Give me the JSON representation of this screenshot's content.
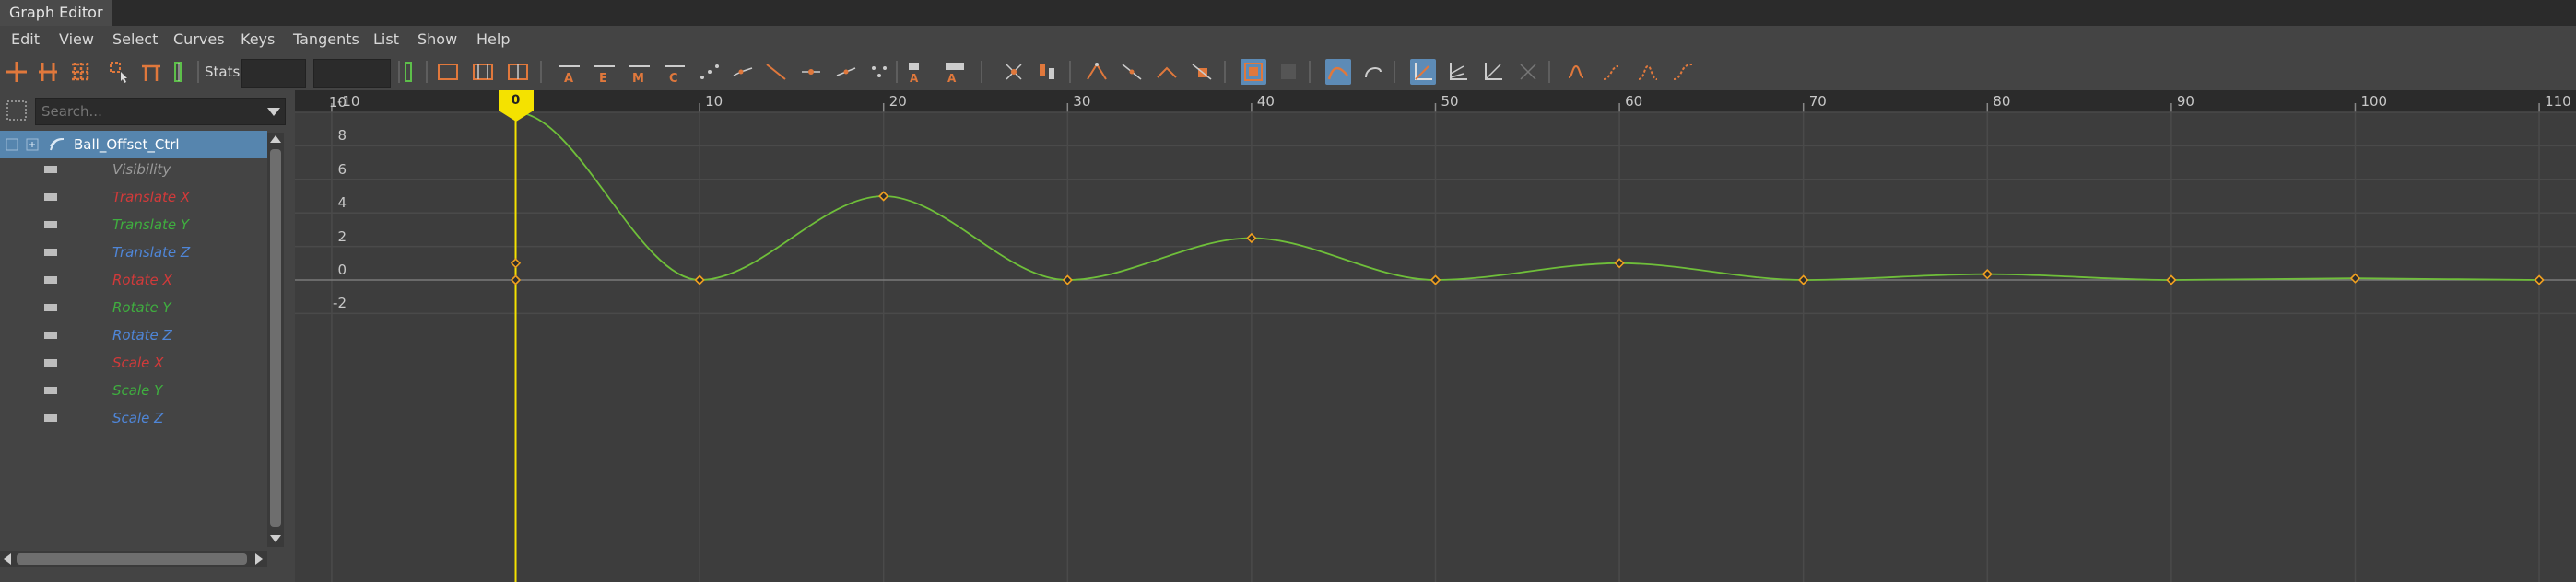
{
  "window": {
    "title": "Graph Editor"
  },
  "menu": [
    "Edit",
    "View",
    "Select",
    "Curves",
    "Keys",
    "Tangents",
    "List",
    "Show",
    "Help"
  ],
  "toolbar": {
    "stats_label": "Stats",
    "icons": [
      "move-keys-icon",
      "insert-keys-icon",
      "lattice-deform-icon",
      "region-select-icon",
      "retime-icon",
      "frame-all-icon",
      "frame-playback-icon",
      "center-current-icon",
      "auto-tangent-icon",
      "spline-tangent-icon",
      "clamped-tangent-icon",
      "linear-tangent-icon",
      "flat-tangent-icon",
      "step-tangent-icon",
      "step-next-icon",
      "plateau-tangent-icon",
      "break-tangents-icon",
      "unify-tangents-icon",
      "free-weights-icon",
      "lock-weights-icon",
      "buffer-curve-icon",
      "swap-buffer-icon",
      "snap-icon",
      "curve-sync-icon",
      "normalize-icon",
      "denormalize-icon",
      "pre-infinity-icon",
      "post-infinity-icon",
      "cycle-icon",
      "oscillate-icon"
    ]
  },
  "outliner": {
    "search_placeholder": "Search...",
    "node": "Ball_Offset_Ctrl",
    "channels": [
      {
        "label": "Visibility",
        "color": "#9a9a9a"
      },
      {
        "label": "Translate X",
        "color": "#d23a3a"
      },
      {
        "label": "Translate Y",
        "color": "#3fae3f"
      },
      {
        "label": "Translate Z",
        "color": "#4f86d8"
      },
      {
        "label": "Rotate X",
        "color": "#d23a3a"
      },
      {
        "label": "Rotate Y",
        "color": "#3fae3f"
      },
      {
        "label": "Rotate Z",
        "color": "#4f86d8"
      },
      {
        "label": "Scale X",
        "color": "#d23a3a"
      },
      {
        "label": "Scale Y",
        "color": "#3fae3f"
      },
      {
        "label": "Scale Z",
        "color": "#4f86d8"
      }
    ]
  },
  "graph": {
    "current_frame": "0",
    "curve_color": "#6fbf3a",
    "key_color": "#f0a020",
    "marker_color": "#f4e200"
  },
  "chart_data": {
    "type": "line",
    "x_ticks": [
      -10,
      0,
      10,
      20,
      30,
      40,
      50,
      60,
      70,
      80,
      90,
      100,
      110
    ],
    "x_tick_labels": [
      "-10",
      "0",
      "10",
      "20",
      "30",
      "40",
      "50",
      "60",
      "70",
      "80",
      "90",
      "100",
      "110"
    ],
    "y_ticks": [
      10,
      8,
      6,
      4,
      2,
      0,
      -2
    ],
    "y_tick_labels": [
      "10",
      "8",
      "6",
      "4",
      "2",
      "0",
      "-2"
    ],
    "xlim": [
      -12,
      112
    ],
    "ylim": [
      -2.5,
      12.2
    ],
    "series": [
      {
        "keys": [
          {
            "x": 0,
            "y": 10
          },
          {
            "x": 10,
            "y": 0
          },
          {
            "x": 20,
            "y": 5
          },
          {
            "x": 30,
            "y": 0
          },
          {
            "x": 40,
            "y": 2.5
          },
          {
            "x": 50,
            "y": 0
          },
          {
            "x": 60,
            "y": 1
          },
          {
            "x": 70,
            "y": 0
          },
          {
            "x": 80,
            "y": 0.35
          },
          {
            "x": 90,
            "y": 0
          },
          {
            "x": 100,
            "y": 0.1
          },
          {
            "x": 110,
            "y": 0
          }
        ]
      }
    ],
    "extra_keys": [
      {
        "x": 0,
        "y": 1
      },
      {
        "x": 0,
        "y": 0
      }
    ]
  }
}
